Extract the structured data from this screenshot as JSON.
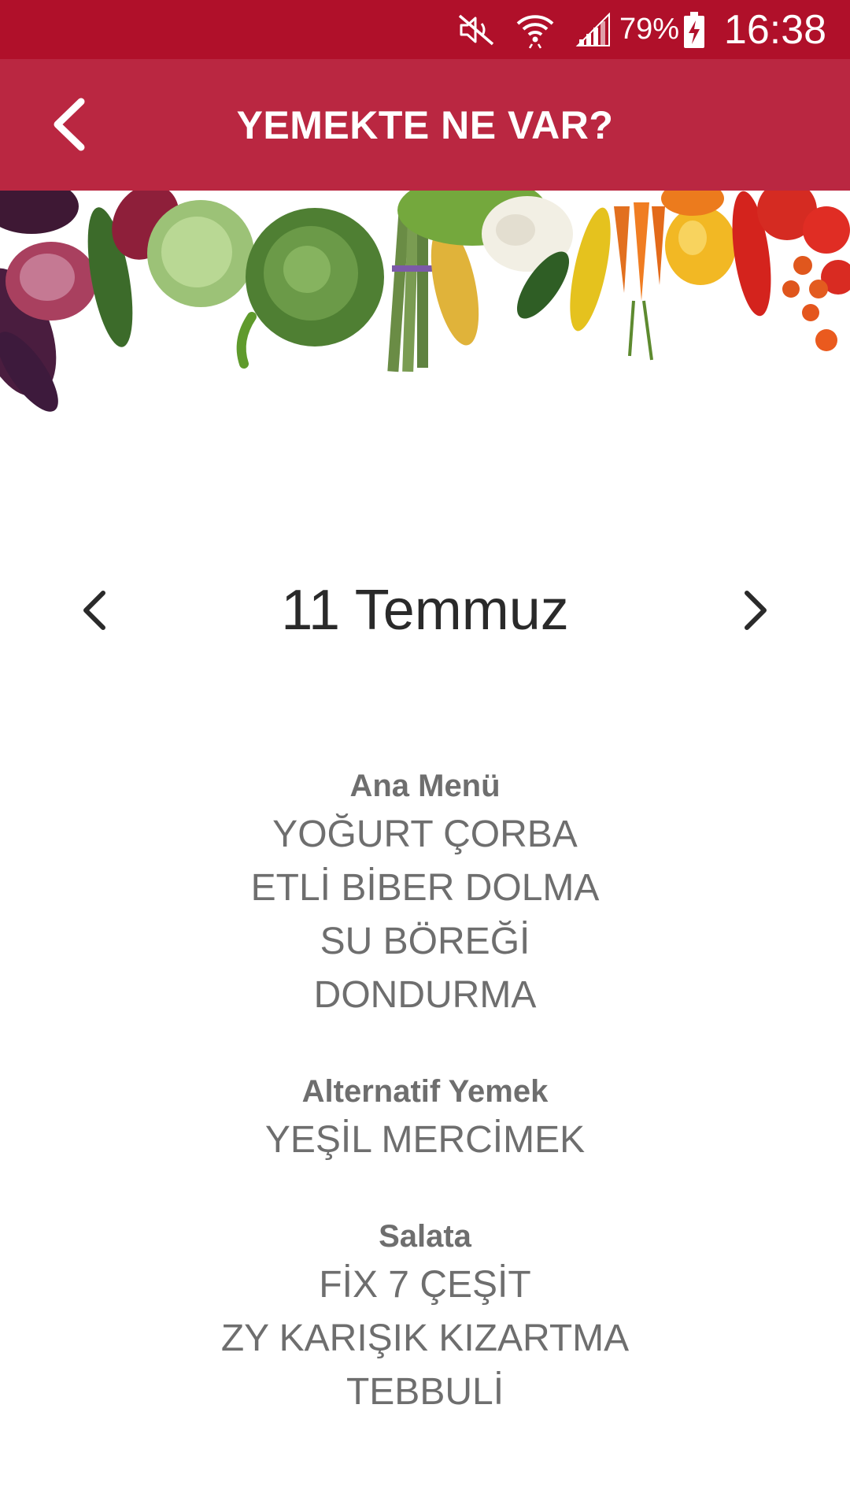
{
  "status_bar": {
    "battery_percent": "79%",
    "time": "16:38",
    "icons": [
      "mute-icon",
      "wifi-icon",
      "signal-icon",
      "battery-charging-icon"
    ]
  },
  "app_bar": {
    "title": "YEMEKTE NE VAR?",
    "background": "#ba2741"
  },
  "date_nav": {
    "date": "11 Temmuz"
  },
  "menu": {
    "sections": [
      {
        "title": "Ana Menü",
        "items": [
          "YOĞURT ÇORBA",
          "ETLİ BİBER DOLMA",
          "SU BÖREĞİ",
          "DONDURMA"
        ]
      },
      {
        "title": "Alternatif Yemek",
        "items": [
          "YEŞİL MERCİMEK"
        ]
      },
      {
        "title": "Salata",
        "items": [
          "FİX 7 ÇEŞİT",
          "ZY KARIŞIK KIZARTMA",
          "TEBBULİ"
        ]
      }
    ]
  },
  "colors": {
    "status_bar": "#b0102a",
    "app_bar": "#ba2741",
    "text_gray": "#6e6e6e",
    "date_text": "#2a2a2a"
  }
}
